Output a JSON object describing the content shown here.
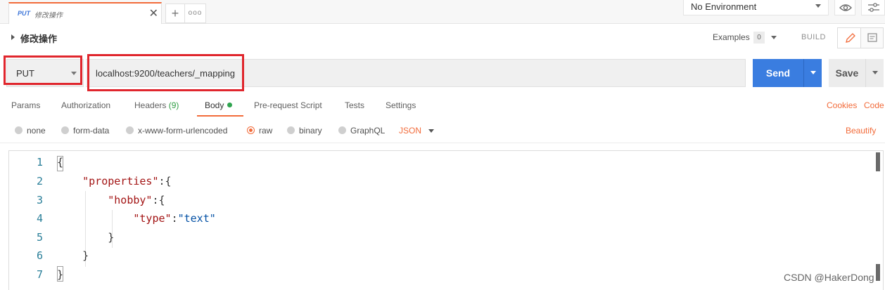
{
  "tab": {
    "method": "PUT",
    "name": "修改操作"
  },
  "environment": {
    "label": "No Environment"
  },
  "request": {
    "title": "修改操作",
    "examples_label": "Examples",
    "examples_count": "0",
    "build_label": "BUILD",
    "method": "PUT",
    "url": "localhost:9200/teachers/_mapping",
    "send_label": "Send",
    "save_label": "Save"
  },
  "request_tabs": [
    {
      "label": "Params"
    },
    {
      "label": "Authorization"
    },
    {
      "label": "Headers",
      "count": "(9)"
    },
    {
      "label": "Body"
    },
    {
      "label": "Pre-request Script"
    },
    {
      "label": "Tests"
    },
    {
      "label": "Settings"
    }
  ],
  "right_links": {
    "cookies": "Cookies",
    "code": "Code"
  },
  "body_types": [
    "none",
    "form-data",
    "x-www-form-urlencoded",
    "raw",
    "binary",
    "GraphQL"
  ],
  "body_language": "JSON",
  "beautify_label": "Beautify",
  "editor": {
    "line_numbers": [
      "1",
      "2",
      "3",
      "4",
      "5",
      "6",
      "7"
    ],
    "lines": [
      {
        "pre": "{"
      },
      {
        "indent": "    ",
        "key": "\"properties\"",
        "rest": ":{"
      },
      {
        "indent": "        ",
        "key": "\"hobby\"",
        "rest": ":{"
      },
      {
        "indent": "            ",
        "key": "\"type\"",
        "colon": ":",
        "value": "\"text\""
      },
      {
        "pre": "        }"
      },
      {
        "pre": "    }"
      },
      {
        "pre": "}"
      }
    ]
  },
  "watermark": "CSDN @HakerDong",
  "colors": {
    "accent": "#f26b3a",
    "send": "#3a7de0",
    "highlight": "#e0262d",
    "json_key": "#a31515",
    "json_string": "#0451a5"
  }
}
